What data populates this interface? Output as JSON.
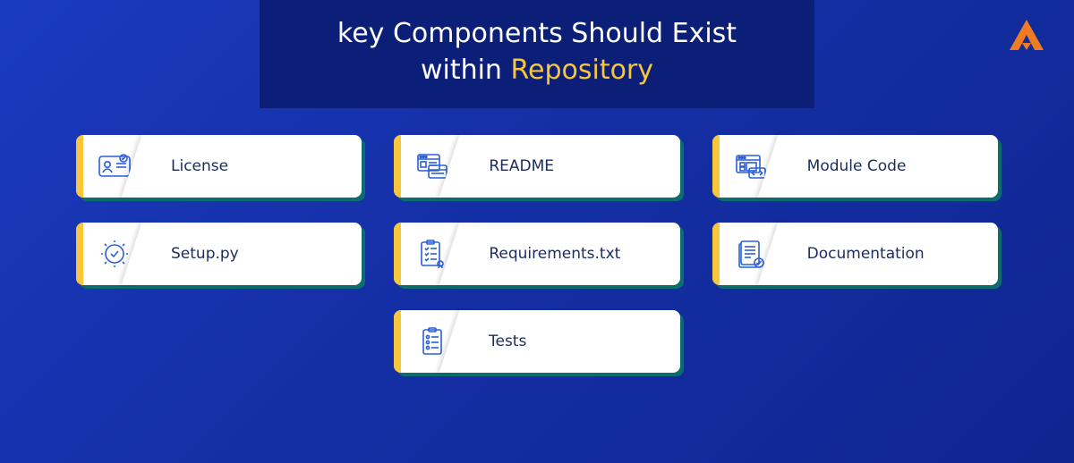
{
  "title": {
    "line1": "key Components Should Exist",
    "line2_prefix": "within ",
    "line2_accent": "Repository"
  },
  "cards": [
    {
      "label": "License",
      "icon": "license-icon"
    },
    {
      "label": "README",
      "icon": "readme-icon"
    },
    {
      "label": "Module Code",
      "icon": "module-code-icon"
    },
    {
      "label": "Setup.py",
      "icon": "setup-icon"
    },
    {
      "label": "Requirements.txt",
      "icon": "requirements-icon"
    },
    {
      "label": "Documentation",
      "icon": "documentation-icon"
    },
    {
      "label": "Tests",
      "icon": "tests-icon"
    }
  ],
  "colors": {
    "accent_yellow": "#f8c63a",
    "card_shadow": "#0b6e6e",
    "icon_stroke": "#2a5fd8",
    "title_bg": "#0b1e78",
    "logo_orange": "#ef7c23"
  }
}
